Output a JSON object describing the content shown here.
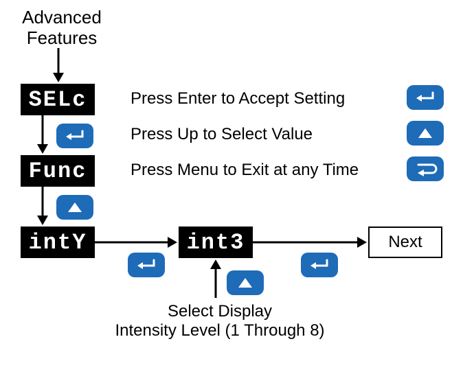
{
  "header": {
    "line1": "Advanced",
    "line2": "Features"
  },
  "lcd": {
    "selc": "SELc",
    "func": "Func",
    "inty": "intY",
    "int3": "int3"
  },
  "legend": {
    "enter": "Press Enter to Accept Setting",
    "up": "Press Up to Select Value",
    "menu": "Press Menu to Exit at any Time"
  },
  "next_label": "Next",
  "caption": {
    "line1": "Select Display",
    "line2": "Intensity Level (1 Through 8)"
  },
  "icons": {
    "enter": "enter-icon",
    "up": "up-icon",
    "menu": "menu-icon"
  },
  "colors": {
    "button_bg": "#1e6bb8",
    "lcd_bg": "#000000",
    "lcd_fg": "#ffffff"
  }
}
